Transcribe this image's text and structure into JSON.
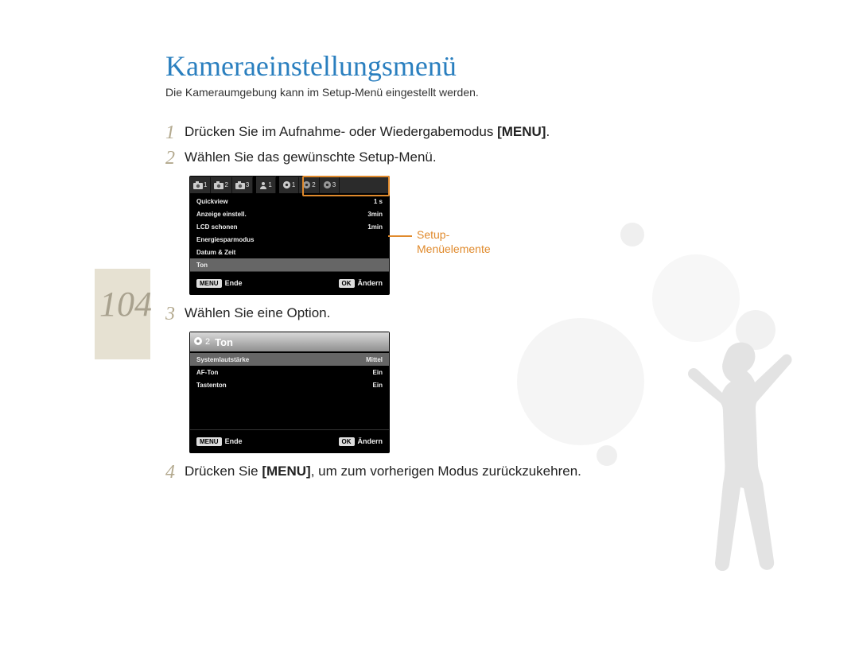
{
  "page_number": "104",
  "title": "Kameraeinstellungsmenü",
  "subtitle": "Die Kameraumgebung kann im Setup-Menü eingestellt werden.",
  "steps": {
    "s1_pre": "Drücken Sie im Aufnahme- oder Wiedergabemodus ",
    "s1_bold": "[MENU]",
    "s1_post": ".",
    "s2": "Wählen Sie das gewünschte Setup-Menü.",
    "s3": "Wählen Sie eine Option.",
    "s4_pre": "Drücken Sie ",
    "s4_bold": "[MENU]",
    "s4_post": ", um zum vorherigen Modus zurückzukehren."
  },
  "step_numbers": {
    "n1": "1",
    "n2": "2",
    "n3": "3",
    "n4": "4"
  },
  "callout": {
    "line1": "Setup-",
    "line2": "Menüelemente"
  },
  "screen1": {
    "tabs": {
      "cam1": "1",
      "cam2": "2",
      "cam3": "3",
      "person": "1",
      "gear1": "1",
      "gear2": "2",
      "gear3": "3"
    },
    "rows": [
      {
        "label": "Quickview",
        "value": "1 s"
      },
      {
        "label": "Anzeige einstell.",
        "value": "3min"
      },
      {
        "label": "LCD schonen",
        "value": "1min"
      },
      {
        "label": "Energiesparmodus",
        "value": ""
      },
      {
        "label": "Datum & Zeit",
        "value": ""
      },
      {
        "label": "Ton",
        "value": ""
      }
    ],
    "footer": {
      "menu": "MENU",
      "menu_label": "Ende",
      "ok": "OK",
      "ok_label": "Ändern"
    }
  },
  "screen2": {
    "header": {
      "num": "2",
      "title": "Ton"
    },
    "rows": [
      {
        "label": "Systemlautstärke",
        "value": "Mittel"
      },
      {
        "label": "AF-Ton",
        "value": "Ein"
      },
      {
        "label": "Tastenton",
        "value": "Ein"
      }
    ],
    "footer": {
      "menu": "MENU",
      "menu_label": "Ende",
      "ok": "OK",
      "ok_label": "Ändern"
    }
  },
  "icons": {
    "camera": "camera-icon",
    "person": "person-icon",
    "gear": "gear-icon"
  },
  "colors": {
    "accent": "#e08a2c",
    "title": "#2a7fbf"
  }
}
